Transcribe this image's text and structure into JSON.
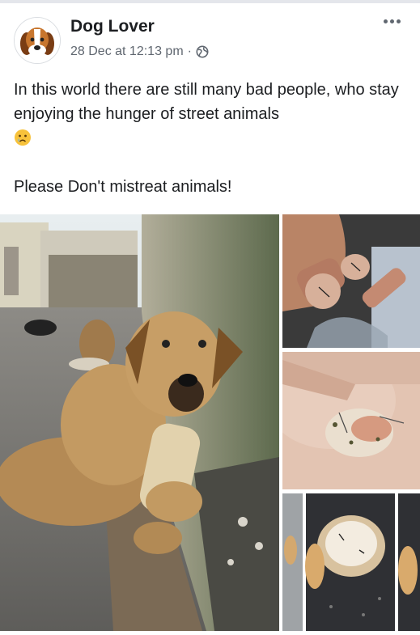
{
  "post": {
    "author": "Dog Lover",
    "timestamp": "28 Dec at 12:13 pm",
    "separator": "·",
    "privacy_icon": "globe-icon",
    "menu_icon": "more-options-icon",
    "text_line1": "In this world there are still many bad people, who stay enjoying the hunger of street animals",
    "emoji": "crying-face-emoji",
    "text_line2": "Please Don't mistreat animals!"
  },
  "photos": [
    {
      "name": "dog-with-bread-photo"
    },
    {
      "name": "hand-holding-sausage-with-pins-photo"
    },
    {
      "name": "hand-holding-bread-with-pins-photo"
    },
    {
      "name": "bread-pieces-on-ground-photo"
    }
  ],
  "colors": {
    "text": "#1c1e21",
    "secondary_text": "#606770",
    "background": "#ffffff"
  }
}
